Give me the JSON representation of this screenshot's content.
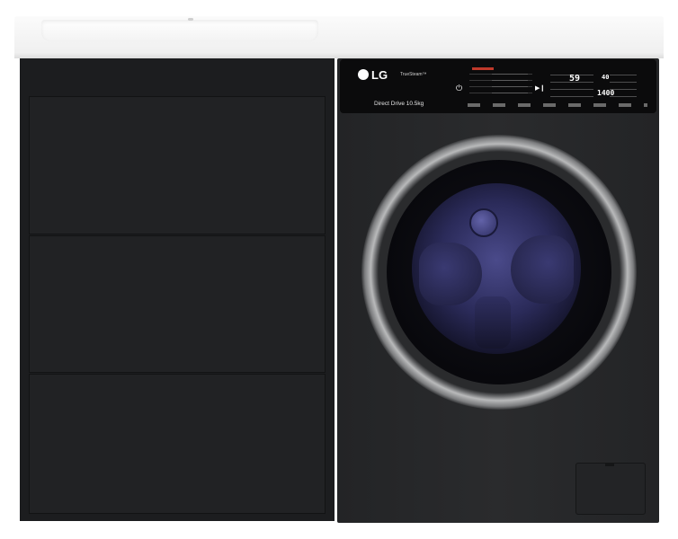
{
  "product": {
    "brand": "LG",
    "feature_badge": "TrueSteam™",
    "model_text": "Direct Drive 10.5kg"
  },
  "control_panel": {
    "time_display": "59",
    "temperature_display": "40",
    "spin_display": "1400"
  },
  "icons": {
    "power": "power-icon",
    "start_pause": "play-pause-icon"
  },
  "colors": {
    "cabinet": "#1c1d1f",
    "washer_body": "#2a2b2d",
    "countertop": "#f3f3f3",
    "drum_accent": "#4a4a8a",
    "door_ring": "#b9babb"
  }
}
